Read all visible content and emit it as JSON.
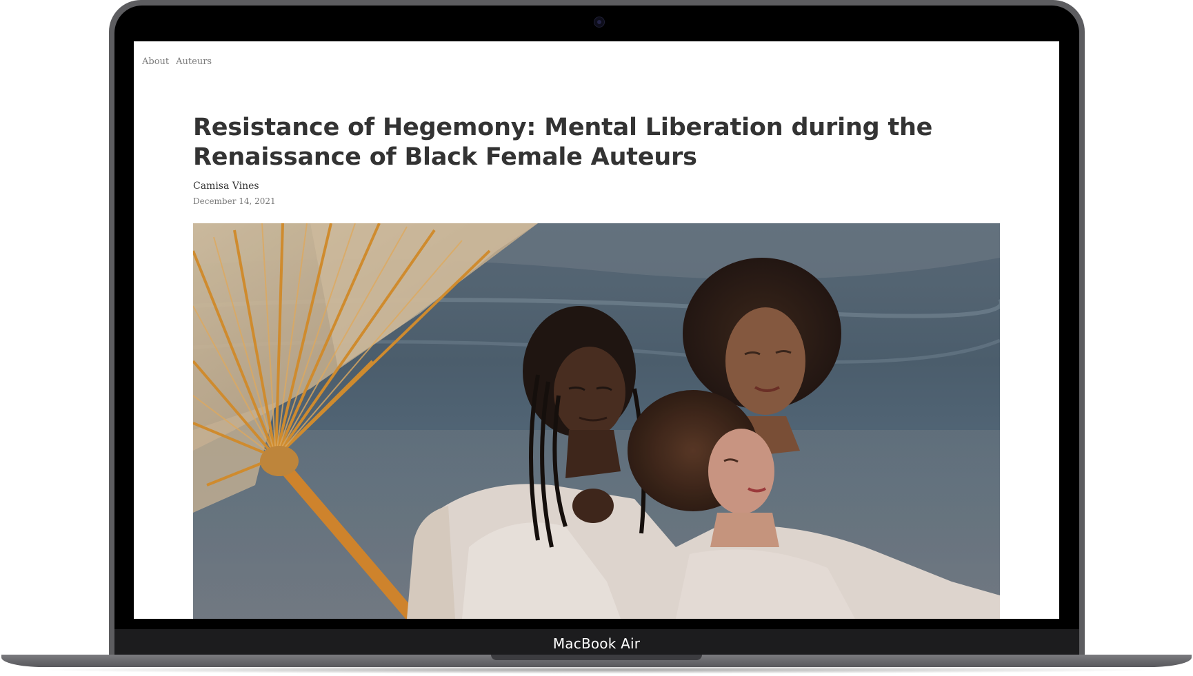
{
  "device": {
    "label": "MacBook Air"
  },
  "nav": {
    "items": [
      {
        "label": "About"
      },
      {
        "label": "Auteurs"
      }
    ]
  },
  "article": {
    "title": "Resistance of Hegemony: Mental Liberation during the Renaissance of Black Female Auteurs",
    "author": "Camisa Vines",
    "date": "December 14, 2021"
  },
  "colors": {
    "page_background": "#ffffff",
    "title_text": "#333333",
    "nav_text": "#7a7a7a",
    "laptop_frame": "#5d5d60",
    "bezel": "#000000"
  },
  "icons": {
    "camera": "webcam-icon"
  }
}
